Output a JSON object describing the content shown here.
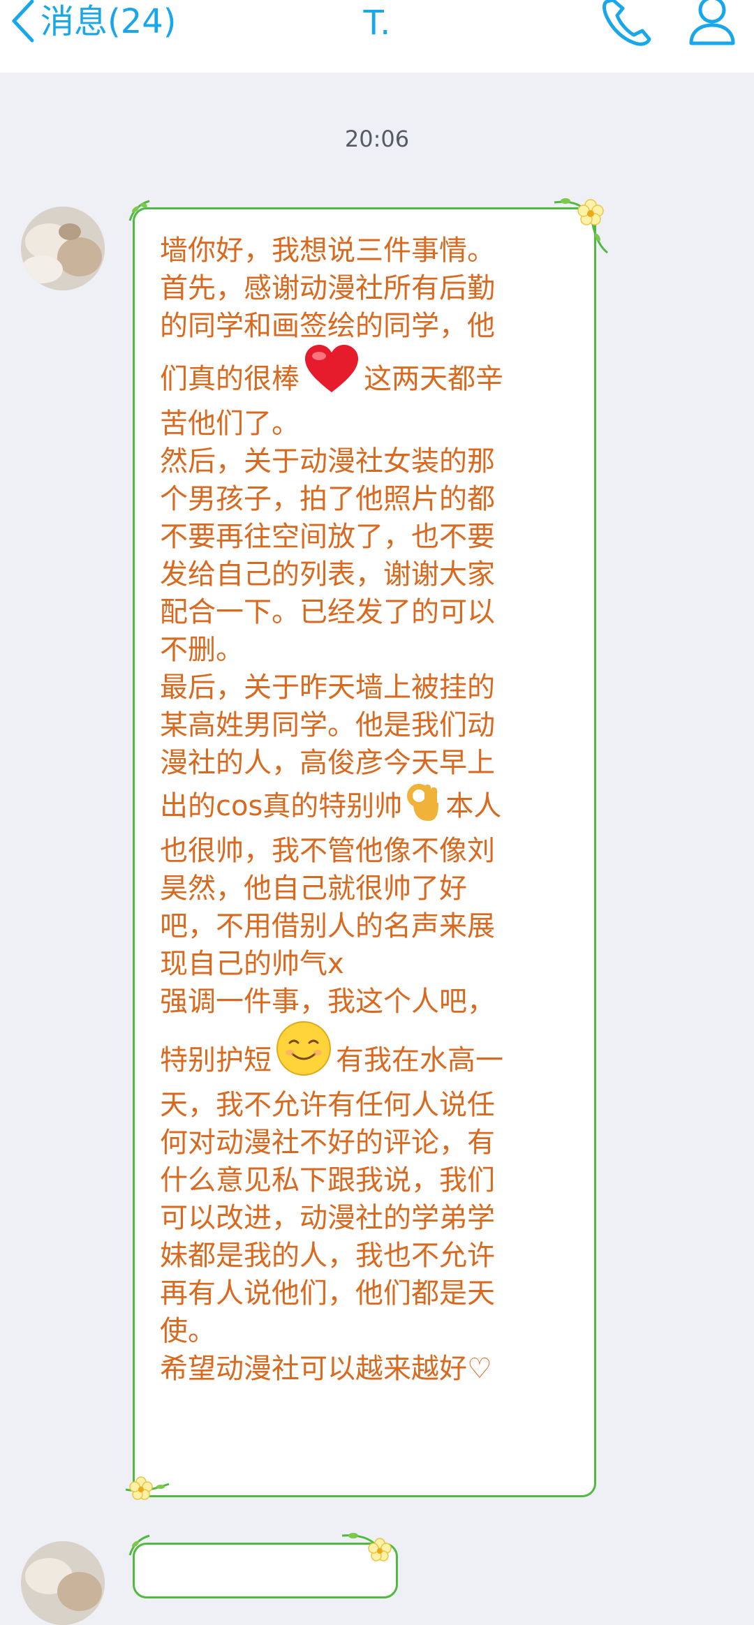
{
  "header": {
    "back_label": "消息(24)",
    "title": "T.",
    "back_icon": "chevron-left-icon",
    "phone_icon": "phone-icon",
    "profile_icon": "person-icon"
  },
  "chat": {
    "timestamp": "20:06",
    "messages": [
      {
        "sender": "T.",
        "lines_1": "墙你好，我想说三件事情。\n首先，感谢动漫社所有后勤\n的同学和画签绘的同学，他\n",
        "line_2a": "们真的很棒",
        "emoji_1": "red-heart-emoji",
        "line_2b": "这两天都辛",
        "lines_3": "苦他们了。\n然后，关于动漫社女装的那\n个男孩子，拍了他照片的都\n不要再往空间放了，也不要\n发给自己的列表，谢谢大家\n配合一下。已经发了的可以\n不删。\n最后，关于昨天墙上被挂的\n某高姓男同学。他是我们动\n漫社的人，高俊彦今天早上\n",
        "line_4a": "出的cos真的特别帅",
        "emoji_2": "ok-hand-emoji",
        "line_4b": "本人",
        "lines_5": "也很帅，我不管他像不像刘\n昊然，他自己就很帅了好\n吧，不用借别人的名声来展\n现自己的帅气x\n强调一件事，我这个人吧，\n",
        "line_6a": "特别护短",
        "emoji_3": "smiling-face-emoji",
        "line_6b": "有我在水高一",
        "lines_7": "天，我不允许有任何人说任\n何对动漫社不好的评论，有\n什么意见私下跟我说，我们\n可以改进，动漫社的学弟学\n妹都是我的人，我也不允许\n再有人说他们，他们都是天\n使。\n希望动漫社可以越来越好♡"
      }
    ]
  },
  "colors": {
    "accent": "#18a7ea",
    "message_text": "#d9691e",
    "bubble_border": "#4fb940",
    "background": "#eef0f5",
    "header_bg": "#ffffff"
  }
}
